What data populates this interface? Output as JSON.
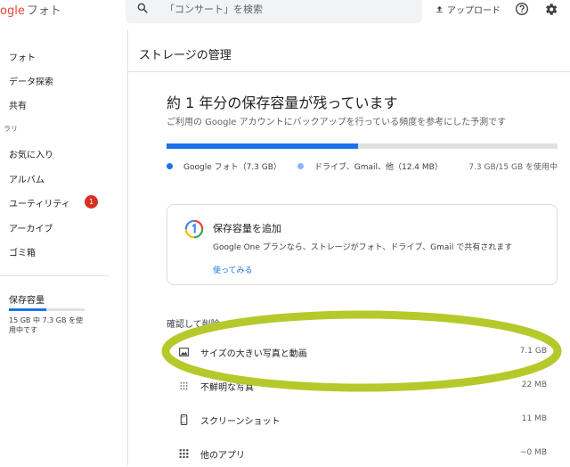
{
  "app": {
    "logo_text": "ogle",
    "name": "フォト"
  },
  "search": {
    "placeholder": "「コンサート」を検索"
  },
  "header": {
    "upload_label": "アップロード",
    "help_icon": "help-circle-icon",
    "settings_icon": "gear-icon"
  },
  "sidebar": {
    "items": [
      {
        "label": "フォト"
      },
      {
        "label": "データ探索"
      },
      {
        "label": "共有"
      }
    ],
    "section_label": "ラリ",
    "library_items": [
      {
        "label": "お気に入り"
      },
      {
        "label": "アルバム"
      },
      {
        "label": "ユーティリティ",
        "badge": "1"
      },
      {
        "label": "アーカイブ"
      },
      {
        "label": "ゴミ箱"
      }
    ],
    "storage": {
      "title": "保存容量",
      "detail": "15 GB 中 7.3 GB を使用中です",
      "used_fraction": 0.49
    }
  },
  "main": {
    "page_title": "ストレージの管理",
    "heading": "約 1 年分の保存容量が残っています",
    "subheading": "ご利用の Google アカウントにバックアップを行っている頻度を参考にした予測です",
    "bar_used_fraction": 0.49,
    "legend": [
      {
        "label": "Google フォト（7.3 GB）",
        "color": "#1a73e8"
      },
      {
        "label": "ドライブ、Gmail、他（12.4 MB）",
        "color": "#8ab4f8"
      }
    ],
    "usage_text": "7.3 GB/15 GB を使用中",
    "card": {
      "title": "保存容量を追加",
      "description": "Google One プランなら、ストレージがフォト、ドライブ、Gmail で共有されます",
      "link": "使ってみる"
    },
    "review_title": "確認して削除",
    "review_items": [
      {
        "label": "サイズの大きい写真と動画",
        "size": "7.1 GB",
        "icon": "photo-icon"
      },
      {
        "label": "不鮮明な写真",
        "size": "22 MB",
        "icon": "blur-icon"
      },
      {
        "label": "スクリーンショット",
        "size": "11 MB",
        "icon": "phone-screenshot-icon"
      },
      {
        "label": "他のアプリ",
        "size": "~0 MB",
        "icon": "apps-grid-icon"
      }
    ]
  },
  "colors": {
    "accent": "#1a73e8",
    "highlight": "#b5c92b",
    "badge": "#d93025"
  }
}
